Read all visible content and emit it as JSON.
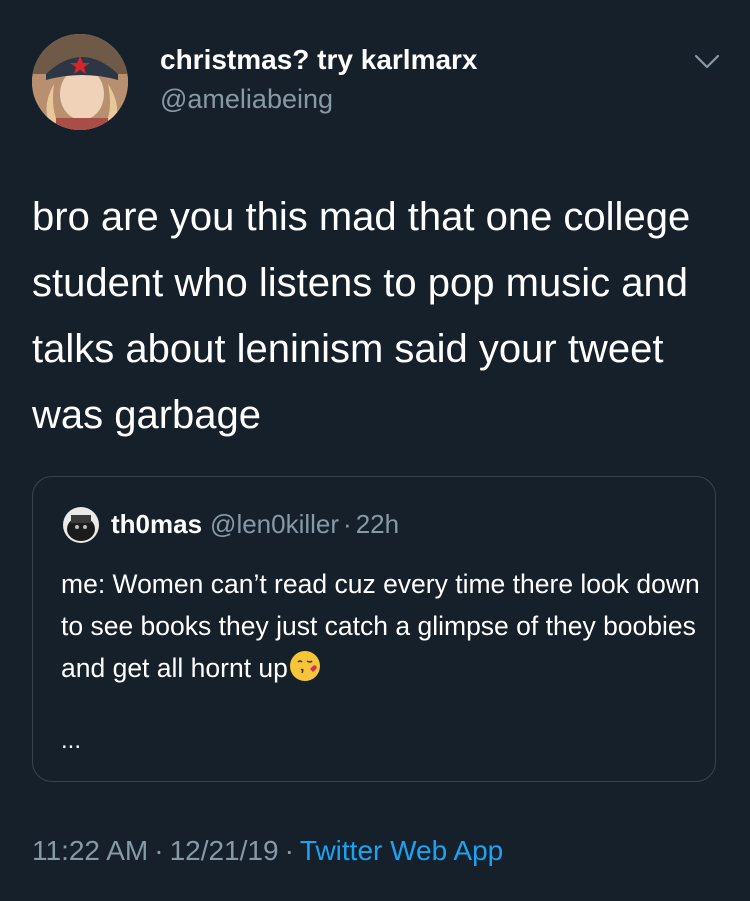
{
  "tweet": {
    "display_name": "christmas? try karlmarx",
    "handle": "@ameliabeing",
    "text": "bro are you this mad that one college student who listens to pop music and talks about leninism said your tweet was garbage"
  },
  "quoted_tweet": {
    "name": "th0mas",
    "handle": "@len0killer",
    "separator": "·",
    "time": "22h",
    "text": "me: Women can’t read cuz every time there look down to see books they just catch a glimpse of they boobies and get all hornt up",
    "emoji": "kissing-face-with-heart-icon",
    "ellipsis": "..."
  },
  "meta": {
    "time": "11:22 AM",
    "date": "12/21/19",
    "separator": "·",
    "source": "Twitter Web App"
  },
  "colors": {
    "background": "#15202b",
    "text_primary": "#ffffff",
    "text_secondary": "#8899a6",
    "link": "#1da1f2",
    "border": "#38444d"
  }
}
